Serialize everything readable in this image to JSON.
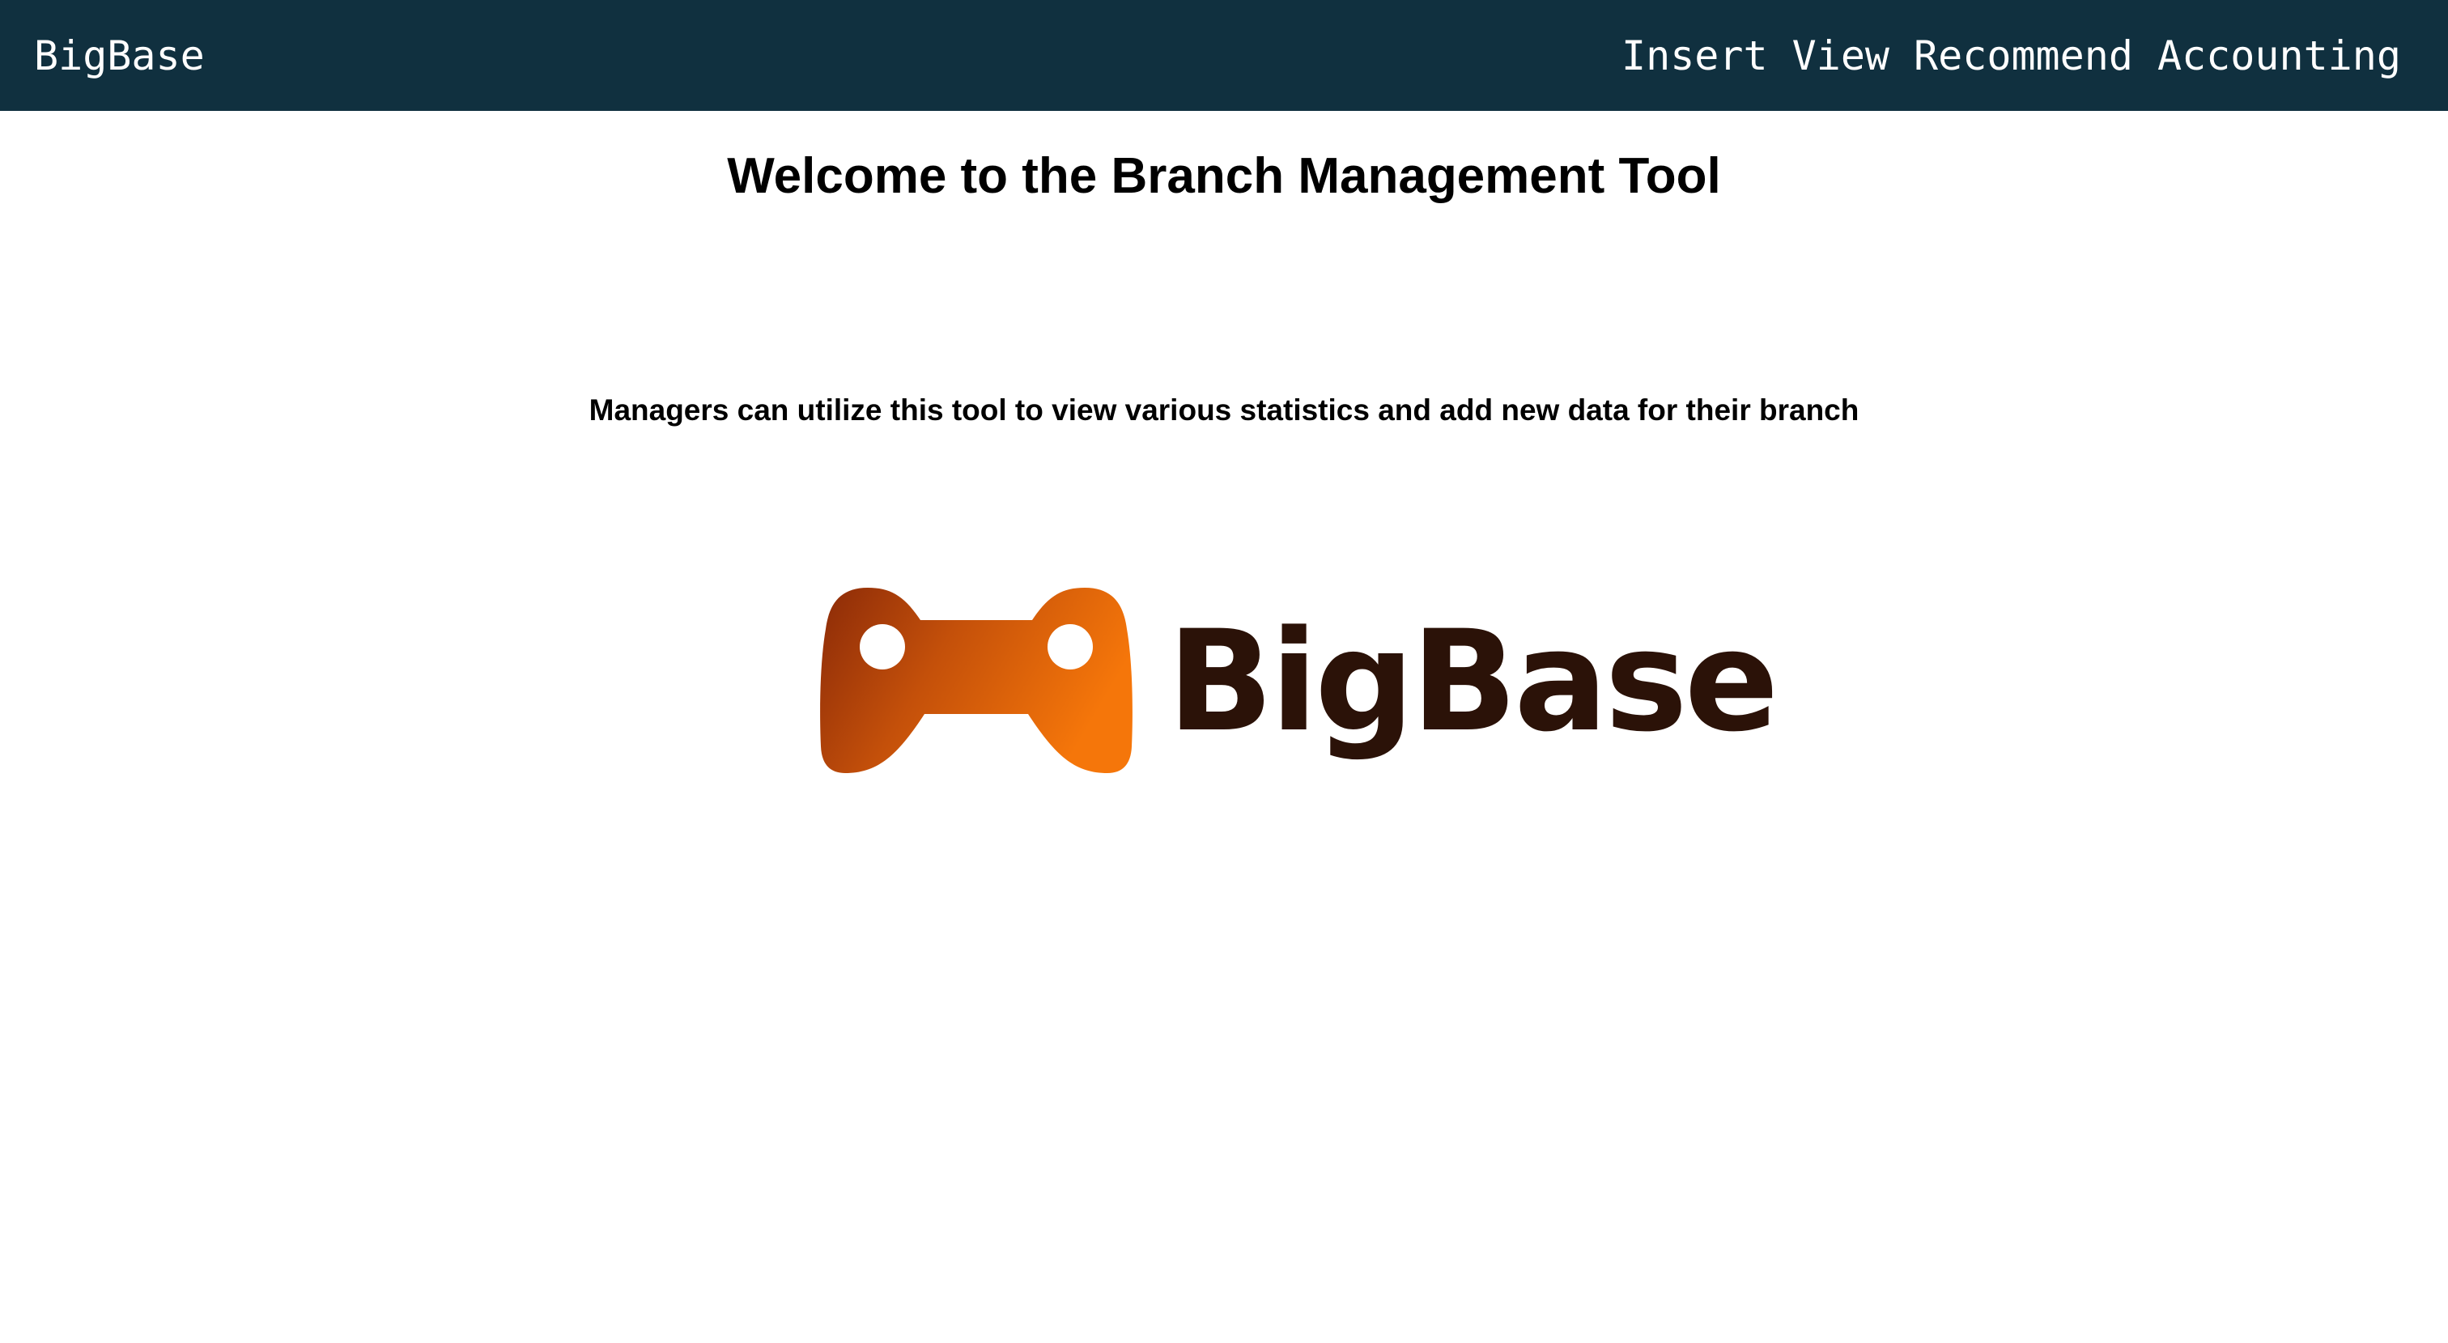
{
  "colors": {
    "nav_background": "#10303f",
    "nav_text": "#ffffff",
    "logo_gradient_start": "#8b2a08",
    "logo_gradient_mid": "#c4500a",
    "logo_gradient_end": "#f5760a",
    "logo_text": "#2b1208"
  },
  "navbar": {
    "brand": "BigBase",
    "links": [
      "Insert",
      "View",
      "Recommend",
      "Accounting"
    ]
  },
  "main": {
    "title": "Welcome to the Branch Management Tool",
    "subtitle": "Managers can utilize this tool to view various statistics and add new data for their branch"
  },
  "logo": {
    "icon": "gamepad-icon",
    "text": "BigBase"
  }
}
